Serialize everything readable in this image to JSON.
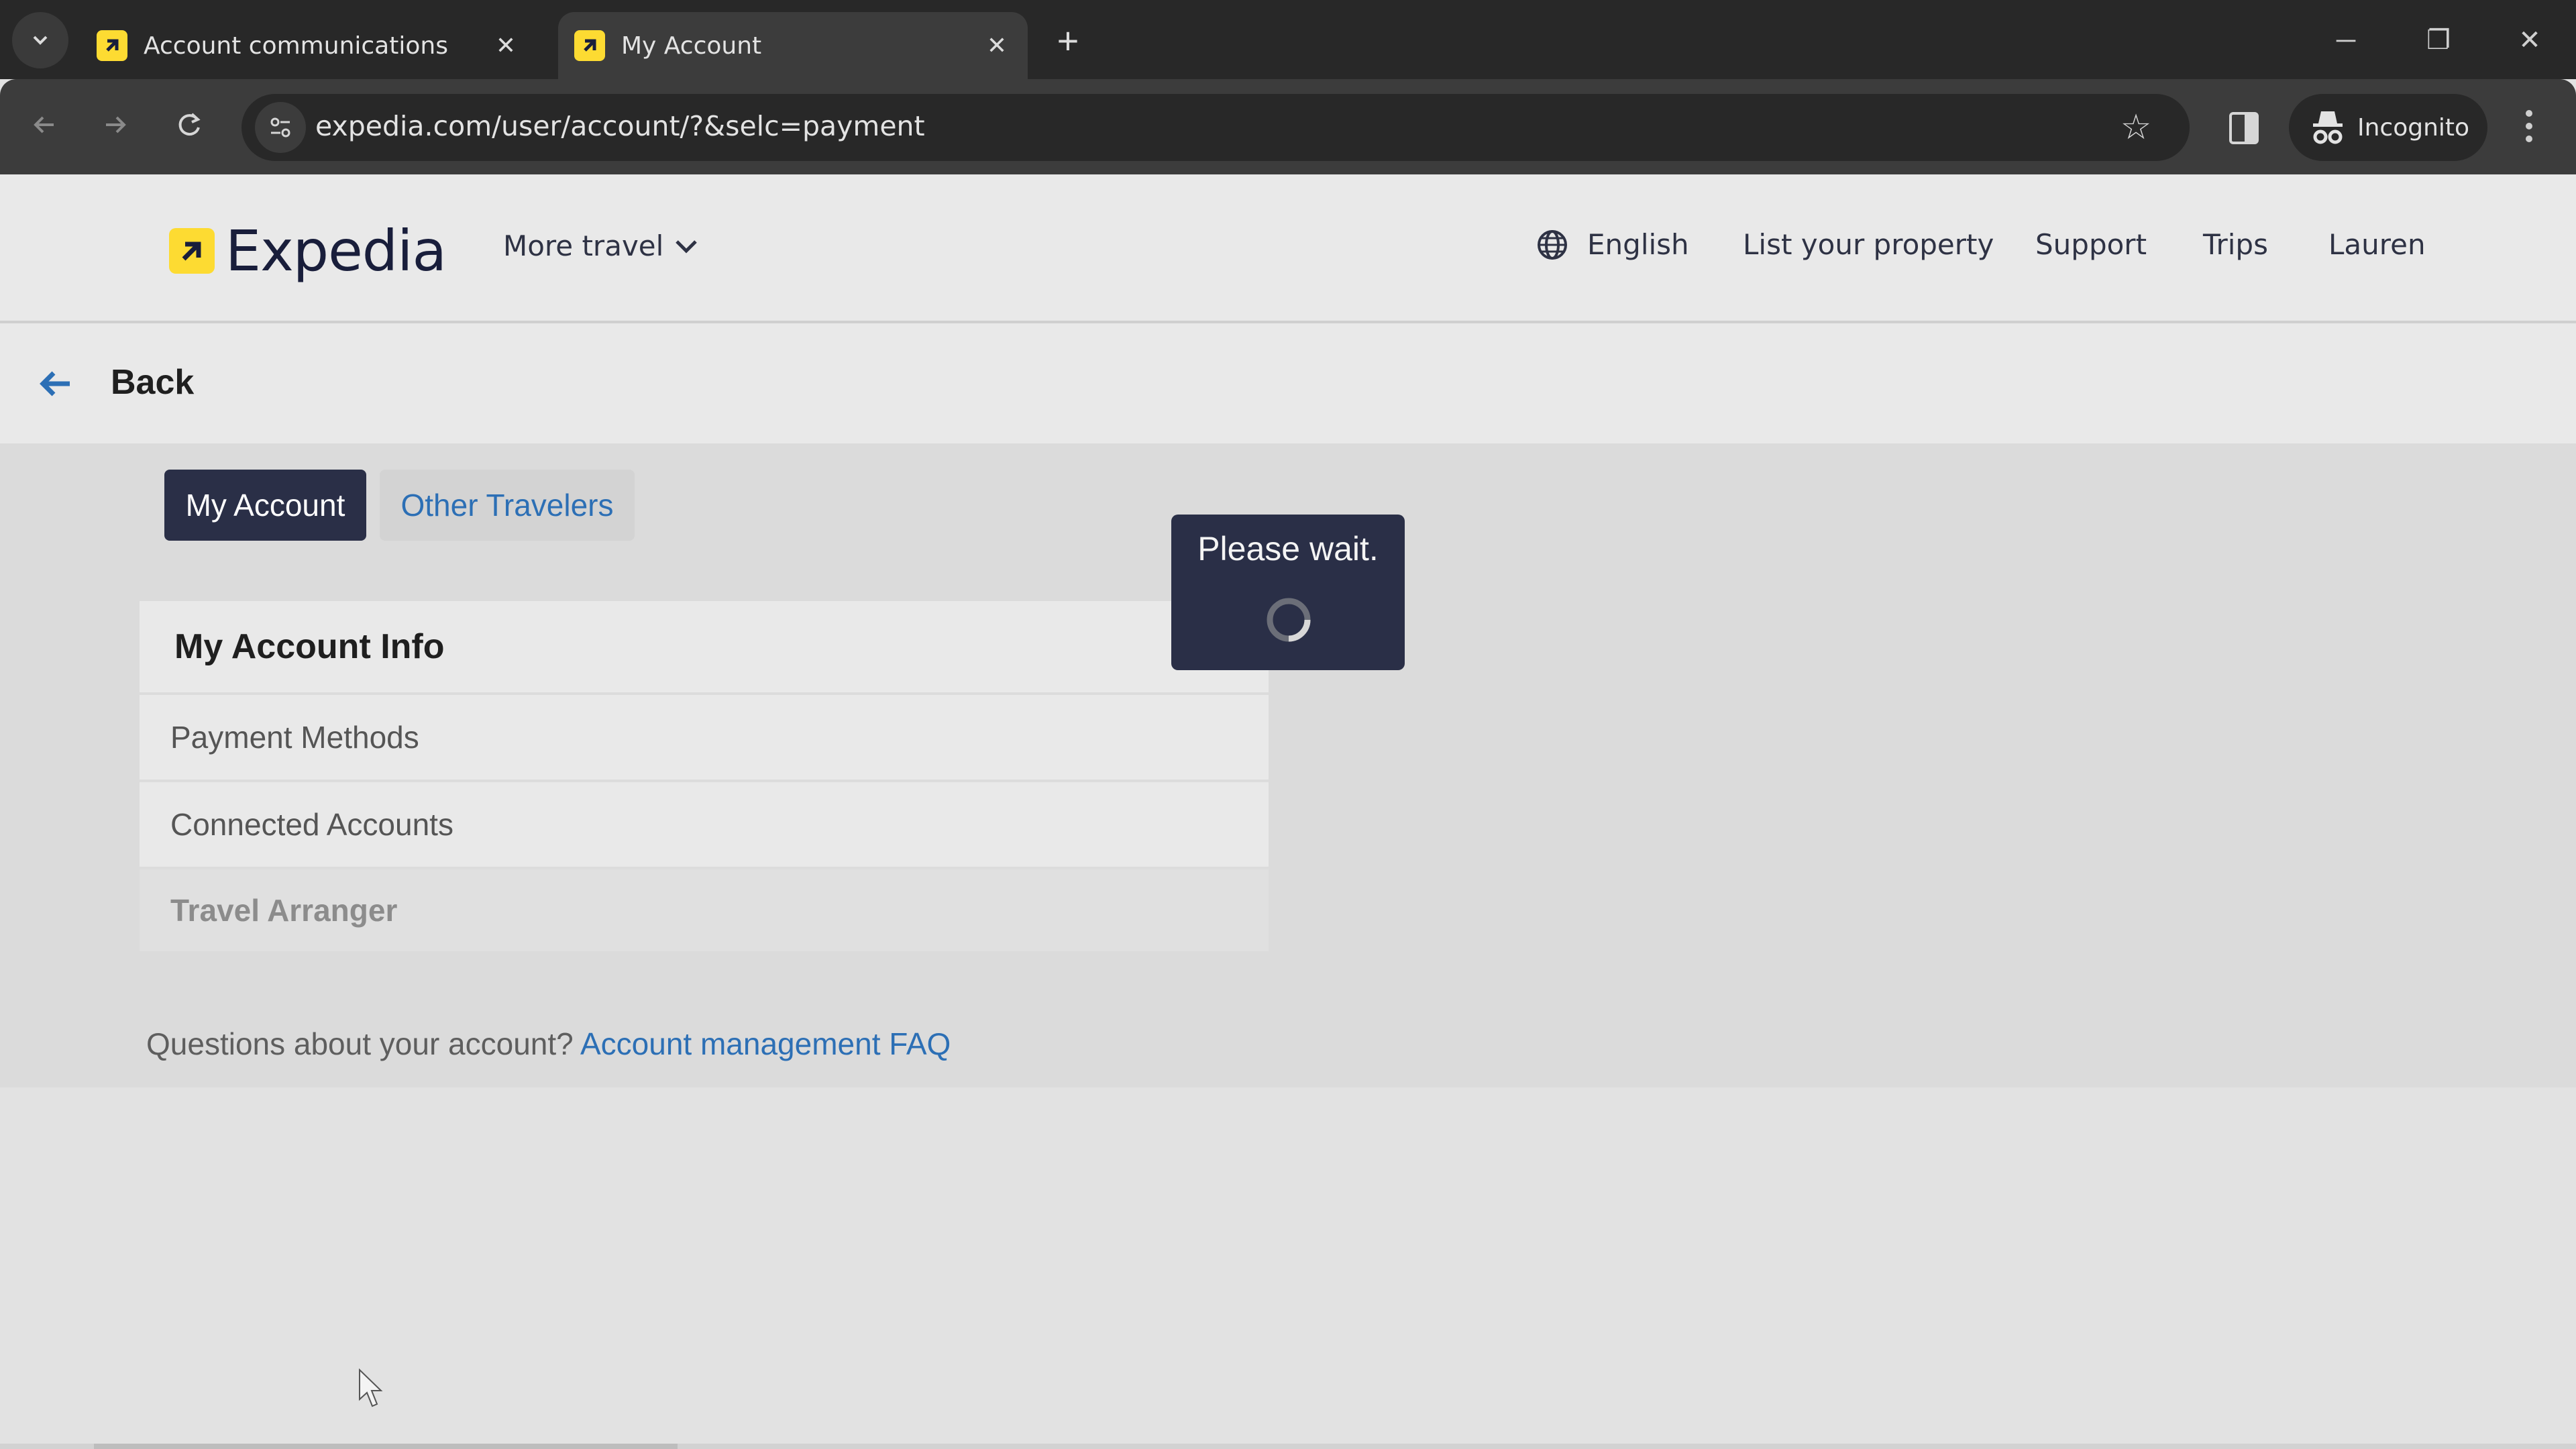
{
  "browser": {
    "tabs": [
      {
        "title": "Account communications",
        "active": false,
        "favicon": "expedia-favicon"
      },
      {
        "title": "My Account",
        "active": true,
        "favicon": "expedia-favicon"
      }
    ],
    "new_tab_label": "+",
    "close_glyph": "✕",
    "url": "expedia.com/user/account/?&selc=payment",
    "profile_label": "Incognito",
    "window_controls": {
      "minimize": "─",
      "restore": "❐",
      "close": "✕"
    }
  },
  "header": {
    "brand": "Expedia",
    "more_travel": "More travel",
    "nav": [
      "English",
      "List your property",
      "Support",
      "Trips",
      "Lauren"
    ]
  },
  "back": {
    "label": "Back"
  },
  "account_tabs": {
    "my_account": "My Account",
    "other_travelers": "Other Travelers"
  },
  "card": {
    "title": "My Account Info",
    "items": [
      {
        "label": "Payment Methods",
        "enabled": true
      },
      {
        "label": "Connected Accounts",
        "enabled": true
      },
      {
        "label": "Travel Arranger",
        "enabled": false
      }
    ]
  },
  "faq": {
    "prefix": "Questions about your account?",
    "link": "Account management FAQ"
  },
  "loading_modal": {
    "text": "Please wait."
  },
  "colors": {
    "brand_yellow": "#fddb32",
    "navy": "#2a2f47",
    "link_blue": "#2c6fb5"
  }
}
